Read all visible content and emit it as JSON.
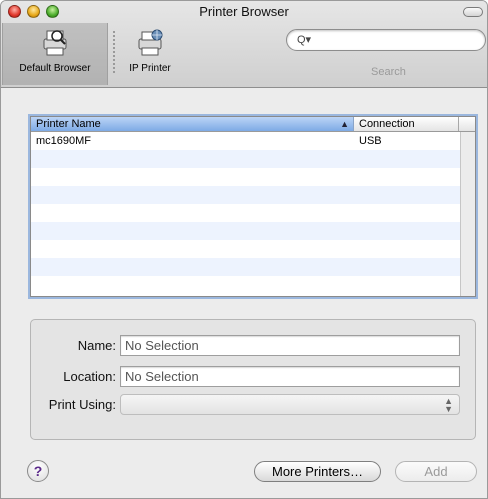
{
  "window": {
    "title": "Printer Browser"
  },
  "toolbar": {
    "default_browser_label": "Default Browser",
    "ip_printer_label": "IP Printer",
    "search_caption": "Search",
    "search_placeholder": ""
  },
  "list": {
    "columns": [
      "Printer Name",
      "Connection"
    ],
    "sort_indicator": "▲",
    "rows": [
      {
        "name": "mc1690MF",
        "connection": "USB"
      }
    ]
  },
  "details": {
    "name_label": "Name:",
    "name_value": "No Selection",
    "location_label": "Location:",
    "location_value": "No Selection",
    "print_using_label": "Print Using:",
    "print_using_value": ""
  },
  "buttons": {
    "help": "?",
    "more_printers": "More Printers…",
    "add": "Add"
  },
  "colors": {
    "selection_header": "#7eaae5",
    "alt_row": "#edf3fe",
    "focus_ring": "#9bb7de"
  }
}
